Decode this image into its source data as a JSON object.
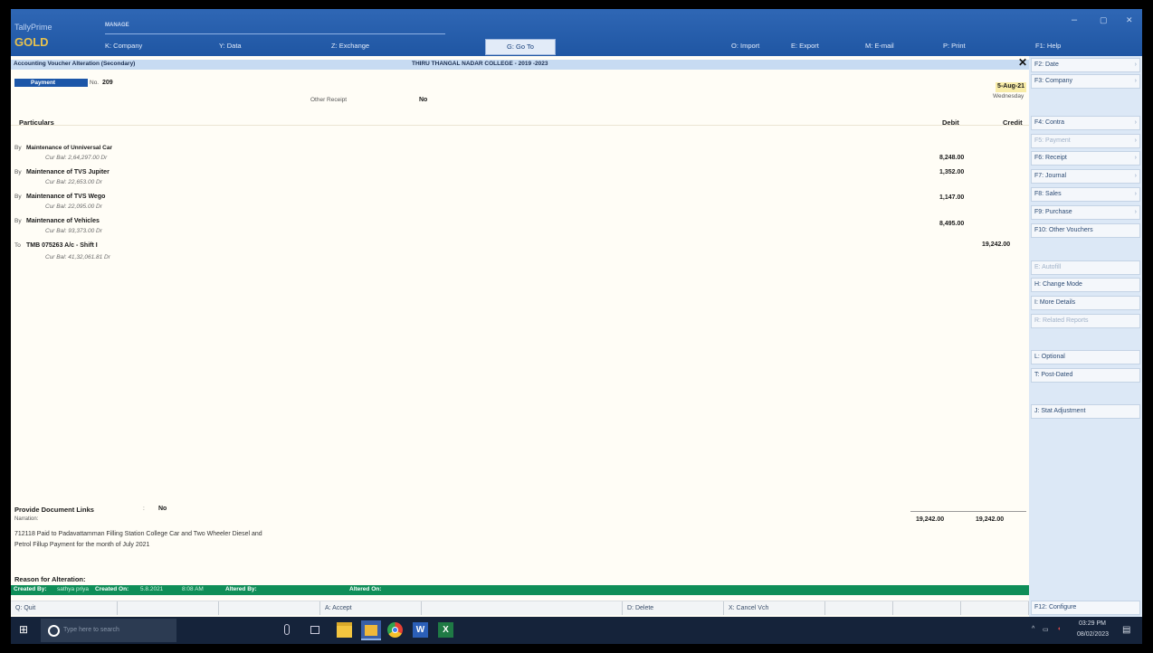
{
  "app": {
    "logo_line1": "TallyPrime",
    "logo_line2": "GOLD",
    "license": "MANAGE"
  },
  "menu": [
    {
      "label": "K: Company"
    },
    {
      "label": "Y: Data"
    },
    {
      "label": "Z: Exchange"
    },
    {
      "label": "G: Go To"
    },
    {
      "label": "O: Import"
    },
    {
      "label": "E: Export"
    },
    {
      "label": "M: E-mail"
    },
    {
      "label": "P: Print"
    },
    {
      "label": "F1: Help"
    }
  ],
  "window_controls": {
    "minimize": "–",
    "maximize": "▢",
    "close": "✕"
  },
  "titlebar": {
    "screen_title": "Accounting Voucher Alteration (Secondary)",
    "company": "THIRU THANGAL NADAR COLLEGE - 2019 -2023",
    "close": "✕"
  },
  "voucher": {
    "type": "Payment",
    "no_label": "No.",
    "number": "209",
    "other_receipt_label": "Other Receipt",
    "other_receipt_value": "No",
    "date": "5-Aug-21",
    "day": "Wednesday"
  },
  "columns": {
    "particulars": "Particulars",
    "debit": "Debit",
    "credit": "Credit"
  },
  "entries": [
    {
      "prefix": "By",
      "ledger": "Maintenance of Unniversal Car",
      "balance": "Cur Bal: 2,64,297.00 Dr",
      "debit": "8,248.00",
      "credit": ""
    },
    {
      "prefix": "By",
      "ledger": "Maintenance of TVS Jupiter",
      "balance": "Cur Bal: 22,653.00 Dr",
      "debit": "1,352.00",
      "credit": ""
    },
    {
      "prefix": "By",
      "ledger": "Maintenance of TVS Wego",
      "balance": "Cur Bal: 22,095.00 Dr",
      "debit": "1,147.00",
      "credit": ""
    },
    {
      "prefix": "By",
      "ledger": "Maintenance of Vehicles",
      "balance": "Cur Bal: 93,373.00 Dr",
      "debit": "8,495.00",
      "credit": ""
    },
    {
      "prefix": "To",
      "ledger": "TMB 075263 A/c - Shift I",
      "balance": "Cur Bal: 41,32,061.81 Dr",
      "debit": "",
      "credit": "19,242.00"
    }
  ],
  "footer": {
    "doc_links_label": "Provide Document Links",
    "doc_links_sep": ":",
    "doc_links_value": "No",
    "narration_label": "Narration:",
    "narration_line1": "712118 Paid to Padavattamman Filling Station College Car and Two Wheeler Diesel and",
    "narration_line2": "Petrol Fillup Payment for the month of July 2021",
    "total_debit": "19,242.00",
    "total_credit": "19,242.00",
    "reason_label": "Reason for Alteration:"
  },
  "status": {
    "created_by_label": "Created By:",
    "created_by": "sathya priya",
    "created_on_label": "Created On:",
    "created_on": "5.8.2021",
    "created_time": "8:08 AM",
    "altered_by_label": "Altered By:",
    "altered_on_label": "Altered On:"
  },
  "bottom_keys": [
    {
      "label": "Q: Quit"
    },
    {
      "label": ""
    },
    {
      "label": ""
    },
    {
      "label": "A: Accept"
    },
    {
      "label": ""
    },
    {
      "label": "D: Delete"
    },
    {
      "label": "X: Cancel Vch"
    },
    {
      "label": ""
    },
    {
      "label": ""
    },
    {
      "label": ""
    }
  ],
  "right_panel": {
    "items": [
      {
        "label": "F2: Date",
        "arrow": "›",
        "disabled": false
      },
      {
        "label": "F3: Company",
        "arrow": "›",
        "disabled": false
      },
      {
        "label": "F4: Contra",
        "arrow": "›",
        "disabled": false
      },
      {
        "label": "F5: Payment",
        "arrow": "›",
        "disabled": true
      },
      {
        "label": "F6: Receipt",
        "arrow": "›",
        "disabled": false
      },
      {
        "label": "F7: Journal",
        "arrow": "›",
        "disabled": false
      },
      {
        "label": "F8: Sales",
        "arrow": "›",
        "disabled": false
      },
      {
        "label": "F9: Purchase",
        "arrow": "›",
        "disabled": false
      },
      {
        "label": "F10: Other Vouchers",
        "arrow": "",
        "disabled": false
      },
      {
        "label": "E: Autofill",
        "arrow": "",
        "disabled": true
      },
      {
        "label": "H: Change Mode",
        "arrow": "",
        "disabled": false
      },
      {
        "label": "I: More Details",
        "arrow": "",
        "disabled": false
      },
      {
        "label": "R: Related Reports",
        "arrow": "",
        "disabled": true
      },
      {
        "label": "L: Optional",
        "arrow": "",
        "disabled": false
      },
      {
        "label": "T: Post-Dated",
        "arrow": "",
        "disabled": false
      },
      {
        "label": "J: Stat Adjustment",
        "arrow": "",
        "disabled": false
      },
      {
        "label": "F12: Configure",
        "arrow": "",
        "disabled": false
      }
    ]
  },
  "taskbar": {
    "search_placeholder": "Type here to search",
    "time": "03:29 PM",
    "date": "08/02/2023"
  }
}
